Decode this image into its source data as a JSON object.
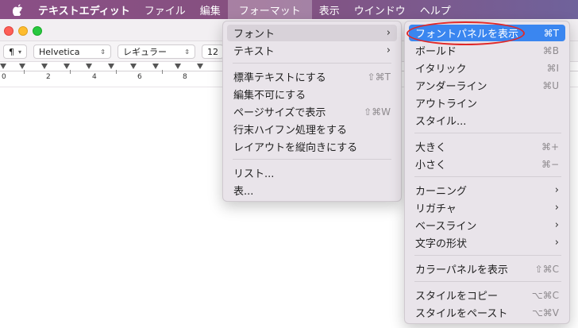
{
  "menubar": {
    "app_name": "テキストエディット",
    "items": [
      "ファイル",
      "編集",
      "フォーマット",
      "表示",
      "ウインドウ",
      "ヘルプ"
    ]
  },
  "toolbar": {
    "paragraph": "¶",
    "font": "Helvetica",
    "style": "レギュラー",
    "size": "12"
  },
  "ruler": {
    "labels": [
      "0",
      "2",
      "4",
      "6",
      "8"
    ]
  },
  "format_menu": {
    "items": [
      {
        "label": "フォント",
        "shortcut": "",
        "submenu": true
      },
      {
        "label": "テキスト",
        "shortcut": "",
        "submenu": true
      },
      {
        "label": "標準テキストにする",
        "shortcut": "⇧⌘T",
        "submenu": false
      },
      {
        "label": "編集不可にする",
        "shortcut": "",
        "submenu": false
      },
      {
        "label": "ページサイズで表示",
        "shortcut": "⇧⌘W",
        "submenu": false
      },
      {
        "label": "行末ハイフン処理をする",
        "shortcut": "",
        "submenu": false
      },
      {
        "label": "レイアウトを縦向きにする",
        "shortcut": "",
        "submenu": false
      },
      {
        "label": "リスト...",
        "shortcut": "",
        "submenu": false
      },
      {
        "label": "表...",
        "shortcut": "",
        "submenu": false
      }
    ]
  },
  "font_menu": {
    "items": [
      {
        "label": "フォントパネルを表示",
        "shortcut": "⌘T",
        "submenu": false
      },
      {
        "label": "ボールド",
        "shortcut": "⌘B",
        "submenu": false
      },
      {
        "label": "イタリック",
        "shortcut": "⌘I",
        "submenu": false
      },
      {
        "label": "アンダーライン",
        "shortcut": "⌘U",
        "submenu": false
      },
      {
        "label": "アウトライン",
        "shortcut": "",
        "submenu": false
      },
      {
        "label": "スタイル...",
        "shortcut": "",
        "submenu": false
      },
      {
        "label": "大きく",
        "shortcut": "⌘+",
        "submenu": false
      },
      {
        "label": "小さく",
        "shortcut": "⌘−",
        "submenu": false
      },
      {
        "label": "カーニング",
        "shortcut": "",
        "submenu": true
      },
      {
        "label": "リガチャ",
        "shortcut": "",
        "submenu": true
      },
      {
        "label": "ベースライン",
        "shortcut": "",
        "submenu": true
      },
      {
        "label": "文字の形状",
        "shortcut": "",
        "submenu": true
      },
      {
        "label": "カラーパネルを表示",
        "shortcut": "⇧⌘C",
        "submenu": false
      },
      {
        "label": "スタイルをコピー",
        "shortcut": "⌥⌘C",
        "submenu": false
      },
      {
        "label": "スタイルをペースト",
        "shortcut": "⌥⌘V",
        "submenu": false
      }
    ]
  },
  "colors": {
    "accent": "#3a86f0",
    "highlight_circle": "#e02828"
  }
}
